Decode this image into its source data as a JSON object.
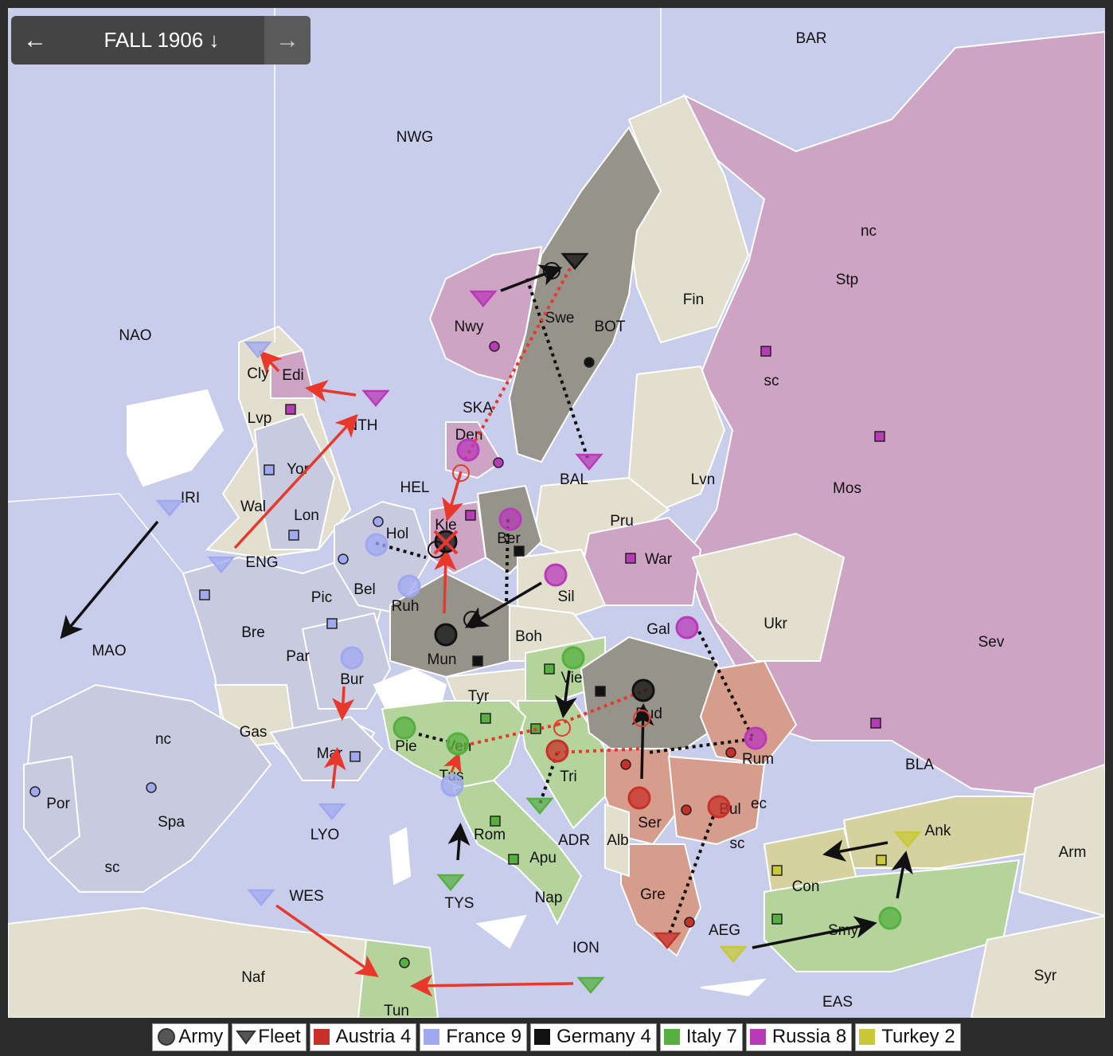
{
  "phase": {
    "label": "FALL 1906 ↓",
    "prev_icon": "←",
    "next_icon": "→"
  },
  "provinces": [
    {
      "label": "BAR"
    },
    {
      "label": "NWG"
    },
    {
      "label": "nc"
    },
    {
      "label": "Stp"
    },
    {
      "label": "Fin"
    },
    {
      "label": "NAO"
    },
    {
      "label": "Swe"
    },
    {
      "label": "Nwy"
    },
    {
      "label": "BOT"
    },
    {
      "label": "sc"
    },
    {
      "label": "Cly"
    },
    {
      "label": "Edi"
    },
    {
      "label": "SKA"
    },
    {
      "label": "NTH"
    },
    {
      "label": "Lvp"
    },
    {
      "label": "Den"
    },
    {
      "label": "Yor"
    },
    {
      "label": "HEL"
    },
    {
      "label": "BAL"
    },
    {
      "label": "Lvn"
    },
    {
      "label": "Mos"
    },
    {
      "label": "IRI"
    },
    {
      "label": "Wal"
    },
    {
      "label": "Lon"
    },
    {
      "label": "Hol"
    },
    {
      "label": "Kie"
    },
    {
      "label": "Ber"
    },
    {
      "label": "Pru"
    },
    {
      "label": "War"
    },
    {
      "label": "ENG"
    },
    {
      "label": "Bel"
    },
    {
      "label": "Pic"
    },
    {
      "label": "Ruh"
    },
    {
      "label": "Sil"
    },
    {
      "label": "Bre"
    },
    {
      "label": "Ukr"
    },
    {
      "label": "MAO"
    },
    {
      "label": "Gal"
    },
    {
      "label": "Boh"
    },
    {
      "label": "Sev"
    },
    {
      "label": "Par"
    },
    {
      "label": "Mun"
    },
    {
      "label": "Bur"
    },
    {
      "label": "Vie"
    },
    {
      "label": "Tyr"
    },
    {
      "label": "Bud"
    },
    {
      "label": "nc"
    },
    {
      "label": "Gas"
    },
    {
      "label": "Pie"
    },
    {
      "label": "Ven"
    },
    {
      "label": "Mar"
    },
    {
      "label": "BLA"
    },
    {
      "label": "Rum"
    },
    {
      "label": "Tri"
    },
    {
      "label": "Tus"
    },
    {
      "label": "Por"
    },
    {
      "label": "Spa"
    },
    {
      "label": "LYO"
    },
    {
      "label": "Ser"
    },
    {
      "label": "Bul"
    },
    {
      "label": "ec"
    },
    {
      "label": "Rom"
    },
    {
      "label": "ADR"
    },
    {
      "label": "Alb"
    },
    {
      "label": "Ank"
    },
    {
      "label": "sc"
    },
    {
      "label": "Arm"
    },
    {
      "label": "Apu"
    },
    {
      "label": "sc"
    },
    {
      "label": "Con"
    },
    {
      "label": "WES"
    },
    {
      "label": "Gre"
    },
    {
      "label": "TYS"
    },
    {
      "label": "Nap"
    },
    {
      "label": "AEG"
    },
    {
      "label": "Smy"
    },
    {
      "label": "ION"
    },
    {
      "label": "Naf"
    },
    {
      "label": "Syr"
    },
    {
      "label": "EAS"
    },
    {
      "label": "Tun"
    }
  ],
  "colors": {
    "Austria": "#c8312a",
    "France": "#a0a8f0",
    "Germany": "#111111",
    "Italy": "#56b040",
    "Russia": "#b83ab8",
    "Turkey": "#c8c838",
    "sea": "#c8cdeb",
    "neutral": "#e2dfcf"
  },
  "legend": [
    {
      "kind": "unit",
      "icon": "army-icon",
      "label": "Army"
    },
    {
      "kind": "unit",
      "icon": "fleet-icon",
      "label": "Fleet"
    },
    {
      "kind": "power",
      "power": "Austria",
      "label": "Austria 4",
      "color": "#c8312a"
    },
    {
      "kind": "power",
      "power": "France",
      "label": "France 9",
      "color": "#a0a8f0"
    },
    {
      "kind": "power",
      "power": "Germany",
      "label": "Germany 4",
      "color": "#111111"
    },
    {
      "kind": "power",
      "power": "Italy",
      "label": "Italy 7",
      "color": "#56b040"
    },
    {
      "kind": "power",
      "power": "Russia",
      "label": "Russia 8",
      "color": "#b83ab8"
    },
    {
      "kind": "power",
      "power": "Turkey",
      "label": "Turkey 2",
      "color": "#c8c838"
    }
  ]
}
